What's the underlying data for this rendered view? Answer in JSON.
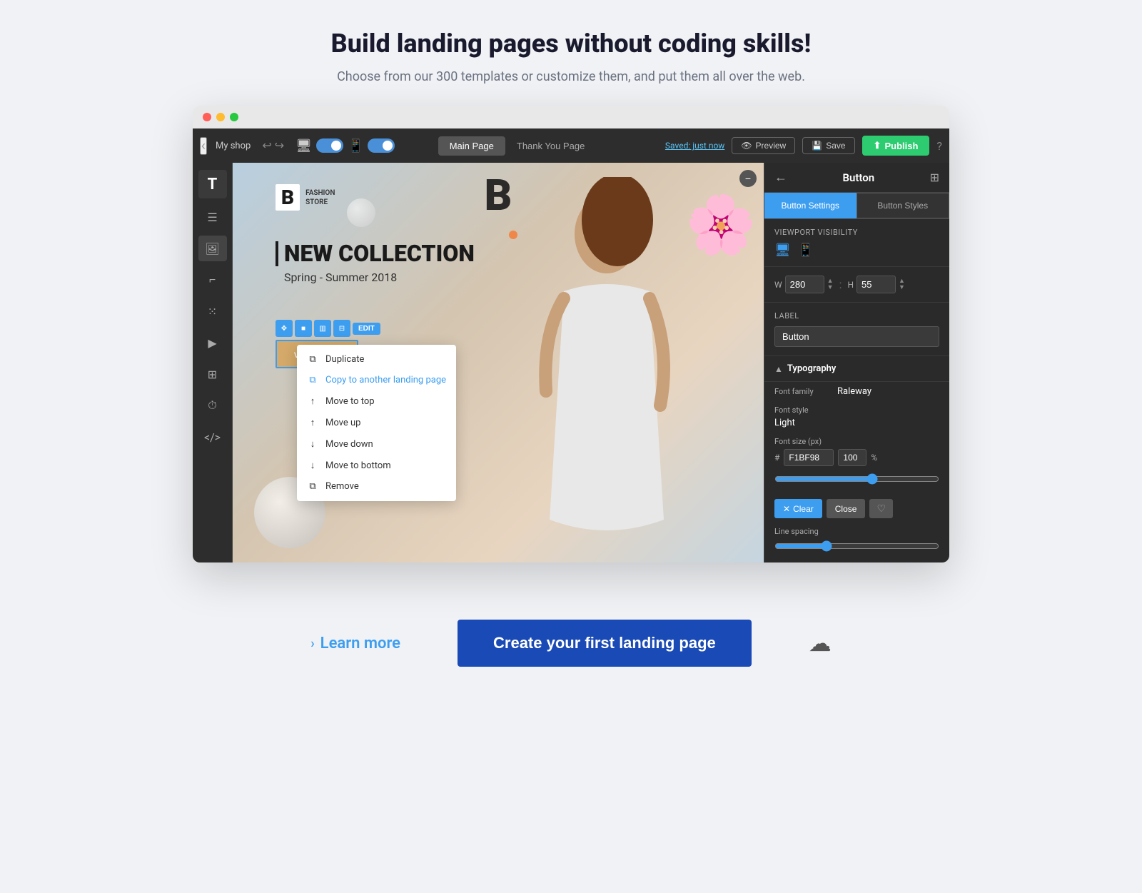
{
  "header": {
    "title": "Build landing pages without coding skills!",
    "subtitle": "Choose from our 300 templates or customize them, and put them all over the web."
  },
  "toolbar": {
    "shop_name": "My shop",
    "tab_main": "Main Page",
    "tab_thank": "Thank You Page",
    "saved_text": "Saved: just now",
    "preview_label": "Preview",
    "save_label": "Save",
    "publish_label": "Publish"
  },
  "panel": {
    "title": "Button",
    "tab_settings": "Button Settings",
    "tab_styles": "Button Styles",
    "viewport_label": "Viewport visibility",
    "w_value": "280",
    "h_value": "55",
    "label_value": "Button",
    "label_text": "Label",
    "typography_title": "Typography",
    "font_family_label": "Font family",
    "font_family_value": "Raleway",
    "font_style_label": "Font style",
    "font_style_value": "Light",
    "font_size_label": "Font size (px)",
    "color_value": "F1BF98",
    "opacity_value": "100",
    "line_spacing_label": "Line spacing",
    "clear_label": "Clear",
    "close_label": "Close"
  },
  "context_menu": {
    "items": [
      {
        "icon": "⧉",
        "label": "Duplicate"
      },
      {
        "icon": "⧉",
        "label": "Copy to another landing page",
        "active": true
      },
      {
        "icon": "↑",
        "label": "Move to top"
      },
      {
        "icon": "↑",
        "label": "Move up"
      },
      {
        "icon": "↓",
        "label": "Move down"
      },
      {
        "icon": "↓",
        "label": "Move to bottom"
      },
      {
        "icon": "⧉",
        "label": "Remove"
      }
    ]
  },
  "fashion": {
    "brand": "B",
    "brand_text_1": "FASHION",
    "brand_text_2": "STORE",
    "heading": "NEW COLLECTION",
    "subheading": "Spring - Summer 2018",
    "button_label": "view more"
  },
  "cta": {
    "learn_more": "Learn more",
    "create_btn": "Create your first landing page"
  },
  "swatches": [
    "#888888",
    "#ffffff",
    "#cccccc",
    "#3d9ef0",
    "#2ecc71"
  ]
}
